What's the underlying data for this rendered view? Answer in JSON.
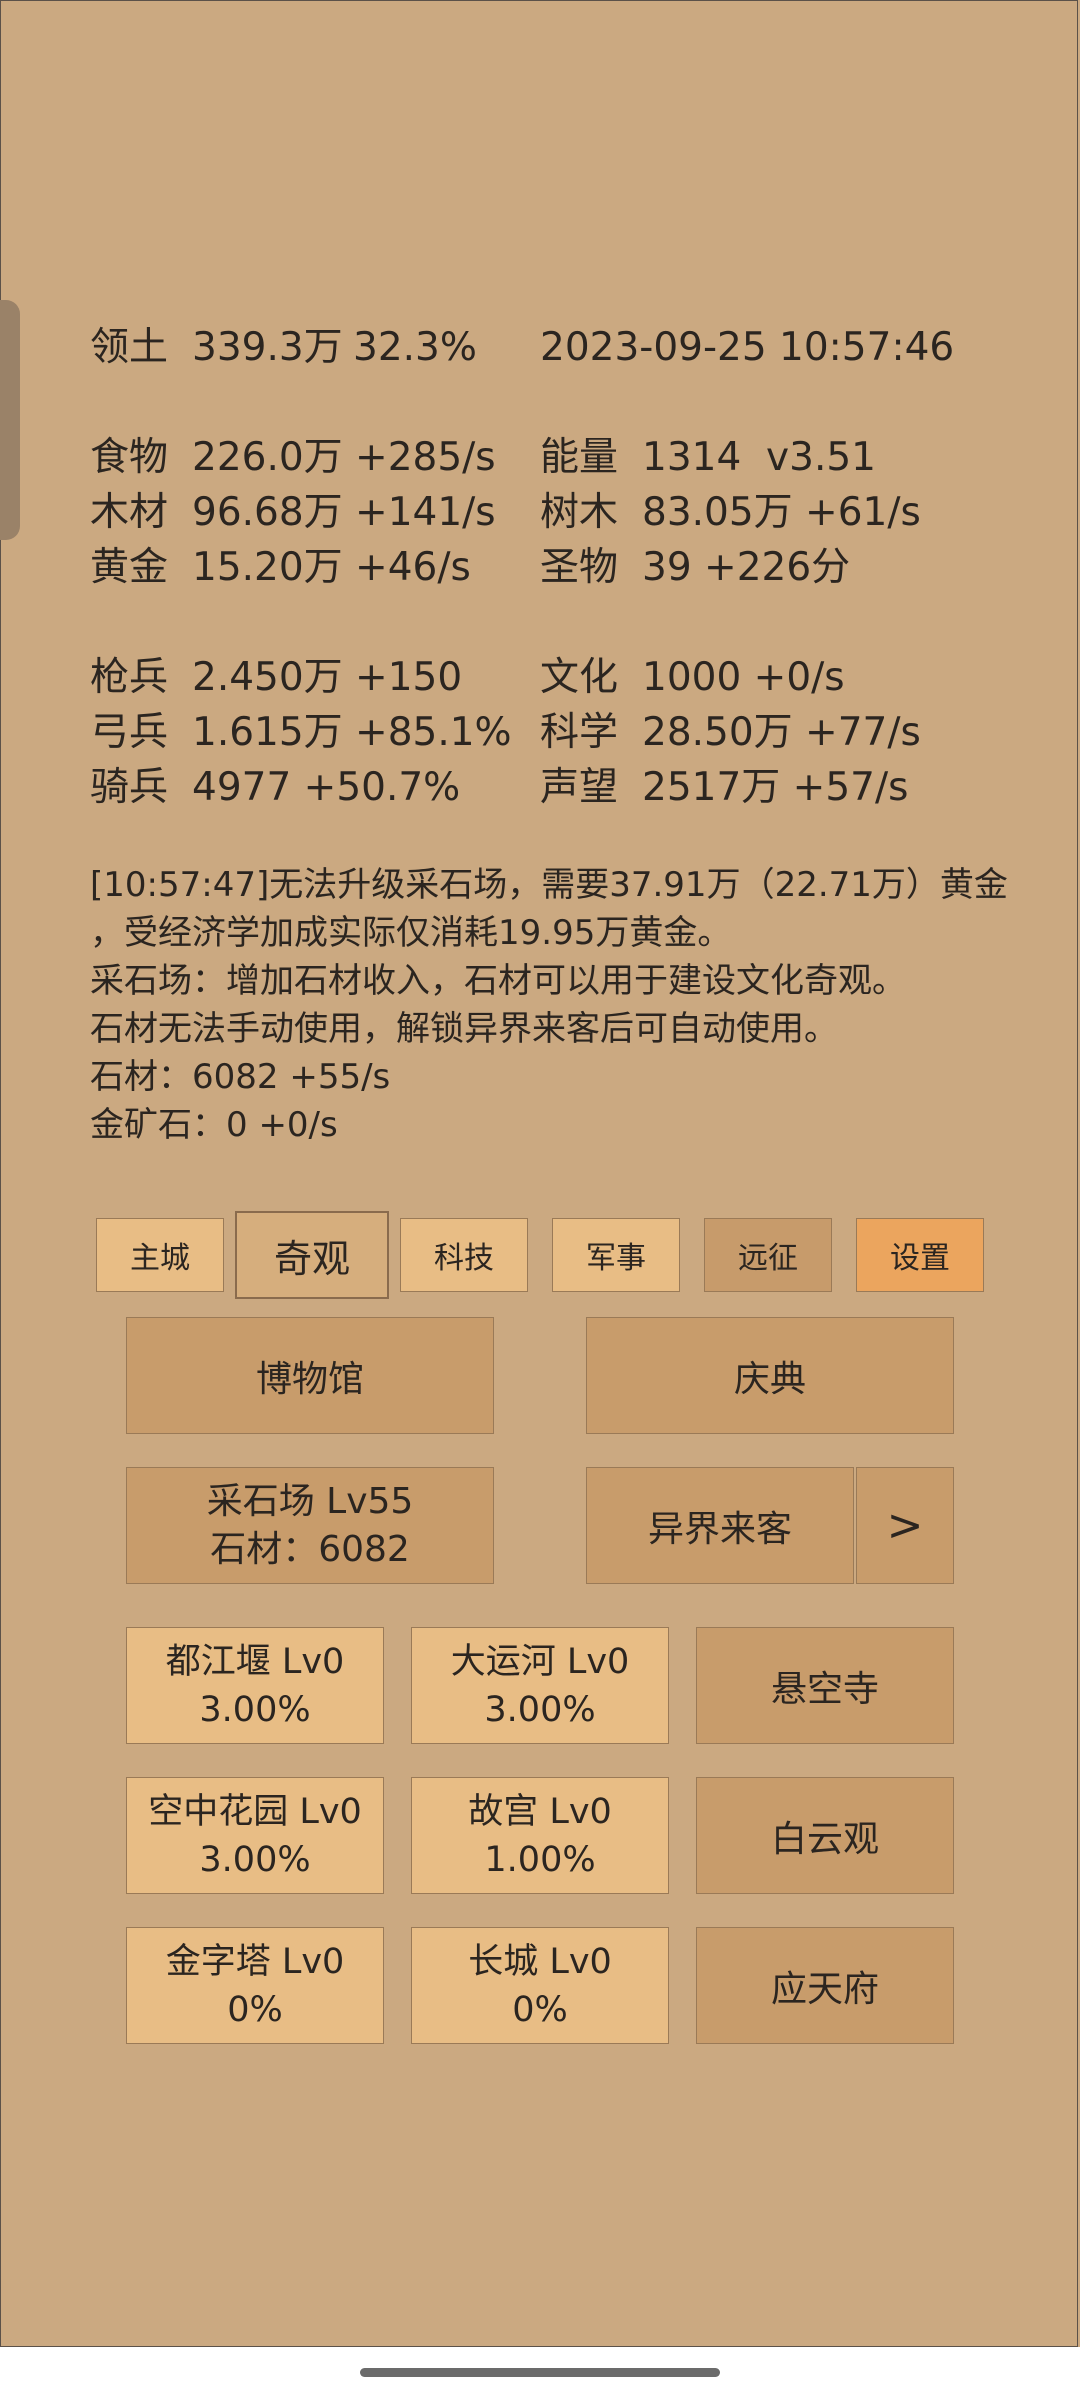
{
  "stats": {
    "territory": {
      "label": "领土",
      "value": "339.3万",
      "percent": "32.3%"
    },
    "datetime": "2023-09-25 10:57:46",
    "food": {
      "label": "食物",
      "value": "226.0万 +285/s"
    },
    "energy": {
      "label": "能量",
      "value": "1314  v3.51"
    },
    "wood": {
      "label": "木材",
      "value": "96.68万 +141/s"
    },
    "trees": {
      "label": "树木",
      "value": "83.05万 +61/s"
    },
    "gold": {
      "label": "黄金",
      "value": "15.20万 +46/s"
    },
    "relics": {
      "label": "圣物",
      "value": "39 +226分"
    },
    "spearmen": {
      "label": "枪兵",
      "value": "2.450万 +150"
    },
    "culture": {
      "label": "文化",
      "value": "1000 +0/s"
    },
    "archers": {
      "label": "弓兵",
      "value": "1.615万 +85.1%"
    },
    "science": {
      "label": "科学",
      "value": "28.50万 +77/s"
    },
    "cavalry": {
      "label": "骑兵",
      "value": "4977 +50.7%"
    },
    "prestige": {
      "label": "声望",
      "value": "2517万 +57/s"
    }
  },
  "messages": [
    "[10:57:47]无法升级采石场，需要37.91万（22.71万）黄金",
    "，受经济学加成实际仅消耗19.95万黄金。",
    "采石场：增加石材收入，石材可以用于建设文化奇观。",
    "石材无法手动使用，解锁异界来客后可自动使用。",
    "石材：6082 +55/s",
    "金矿石：0 +0/s"
  ],
  "tabs": [
    "主城",
    "奇观",
    "科技",
    "军事",
    "远征",
    "设置"
  ],
  "buildings": {
    "museum": "博物馆",
    "festival": "庆典",
    "quarry_name": "采石场 Lv55",
    "quarry_stone": "石材：6082",
    "visitors": "异界来客",
    "next_arrow": ">"
  },
  "wonders": [
    {
      "name": "都江堰 Lv0",
      "value": "3.00%"
    },
    {
      "name": "大运河 Lv0",
      "value": "3.00%"
    },
    {
      "name": "悬空寺"
    },
    {
      "name": "空中花园 Lv0",
      "value": "3.00%"
    },
    {
      "name": "故宫 Lv0",
      "value": "1.00%"
    },
    {
      "name": "白云观"
    },
    {
      "name": "金字塔 Lv0",
      "value": "0%"
    },
    {
      "name": "长城 Lv0",
      "value": "0%"
    },
    {
      "name": "应天府"
    }
  ],
  "colors": {
    "background": "#cba981",
    "tab_light": "#e8bd85",
    "tab_orange": "#eba55e",
    "card_dark": "#c89c6b"
  }
}
